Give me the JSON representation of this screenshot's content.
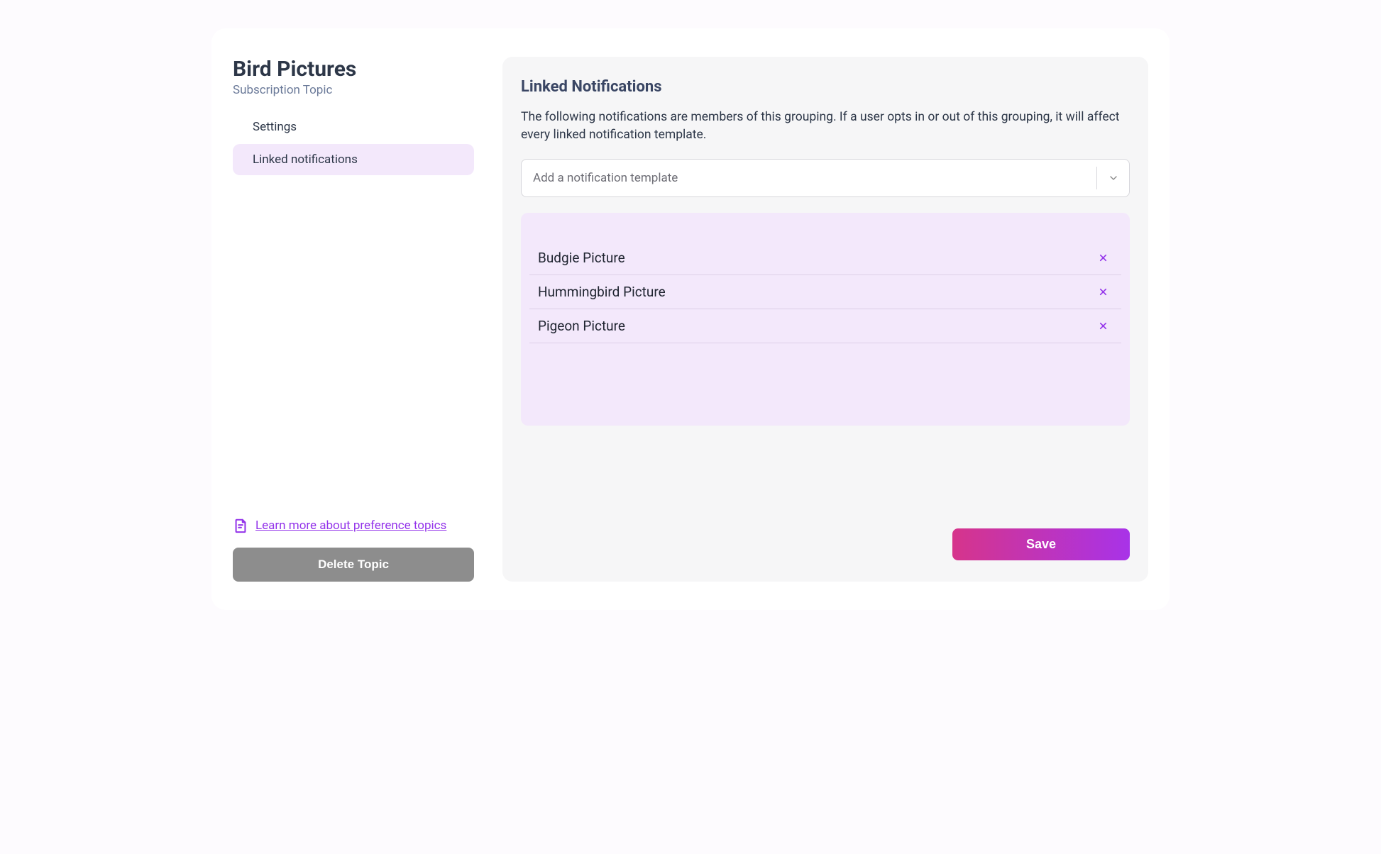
{
  "sidebar": {
    "title": "Bird Pictures",
    "subtitle": "Subscription Topic",
    "nav": [
      {
        "label": "Settings",
        "active": false
      },
      {
        "label": "Linked notifications",
        "active": true
      }
    ],
    "learn_more": "Learn more about preference topics",
    "delete_button": "Delete Topic"
  },
  "main": {
    "title": "Linked Notifications",
    "description": "The following notifications are members of this grouping. If a user opts in or out of this grouping, it will affect every linked notification template.",
    "select_placeholder": "Add a notification template",
    "linked_items": [
      {
        "name": "Budgie Picture"
      },
      {
        "name": "Hummingbird Picture"
      },
      {
        "name": "Pigeon Picture"
      }
    ],
    "save_button": "Save"
  }
}
